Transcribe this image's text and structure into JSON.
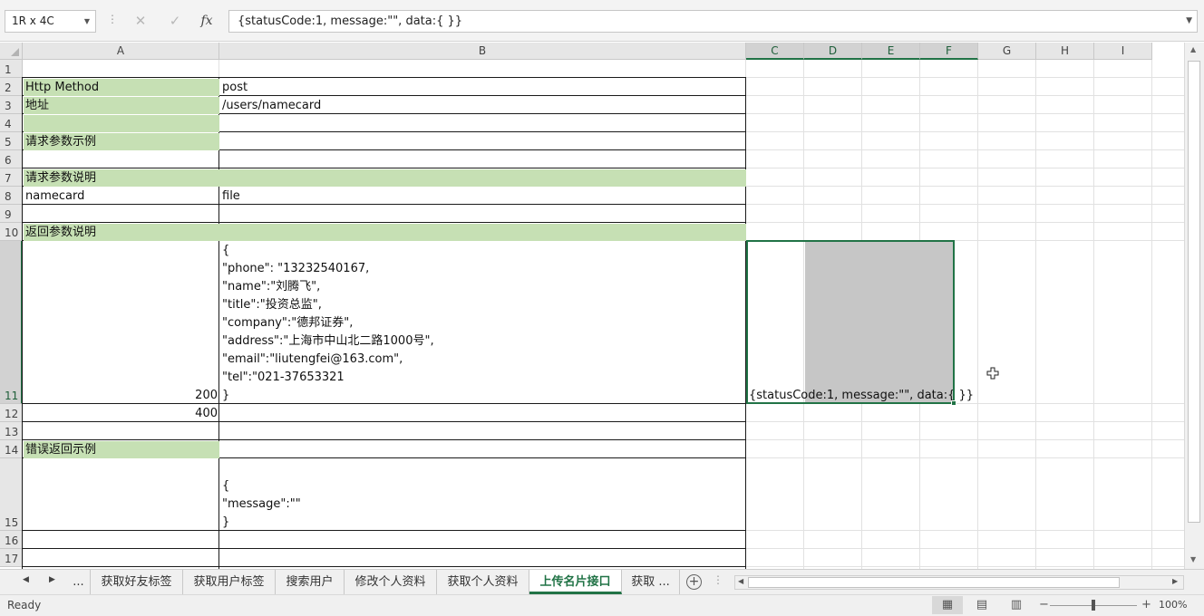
{
  "formula_bar": {
    "name_box": "1R x 4C",
    "cancel_icon": "✕",
    "enter_icon": "✓",
    "fx_label": "fx",
    "formula": "{statusCode:1, message:\"\", data:{  }}"
  },
  "columns": [
    "A",
    "B",
    "C",
    "D",
    "E",
    "F",
    "G",
    "H",
    "I"
  ],
  "rows": [
    "1",
    "2",
    "3",
    "4",
    "5",
    "6",
    "7",
    "8",
    "9",
    "10",
    "11",
    "12",
    "13",
    "14",
    "15",
    "16",
    "17"
  ],
  "cells": {
    "A2": "Http Method",
    "B2": "post",
    "A3": "地址",
    "B3": "/users/namecard",
    "A5": "请求参数示例",
    "A7": "请求参数说明",
    "A8": "namecard",
    "B8": "file",
    "A10": "返回参数说明",
    "B11": [
      "   {",
      "       \"phone\": \"13232540167,",
      "\"name\":\"刘腾飞\",",
      "\"title\":\"投资总监\",",
      "\"company\":\"德邦证券\",",
      "\"address\":\"上海市中山北二路1000号\",",
      "\"email\":\"liutengfei@163.com\",",
      "\"tel\":\"021-37653321",
      "}"
    ],
    "A11": "200",
    "C11": "{statusCode:1, message:\"\", data:{  }}",
    "A12": "400",
    "A14": "错误返回示例",
    "B15": [
      "{",
      "\"message\":\"\"",
      "}"
    ]
  },
  "sheet_tabs": {
    "more_left": "...",
    "tabs": [
      "获取好友标签",
      "获取用户标签",
      "搜索用户",
      "修改个人资料",
      "获取个人资料",
      "上传名片接口",
      "获取 ..."
    ],
    "active": "上传名片接口"
  },
  "status_bar": {
    "ready": "Ready",
    "zoom": "100%"
  },
  "colors": {
    "accent": "#217346",
    "label_fill": "#c6e0b4",
    "selection_fill": "#c6c6c6"
  }
}
